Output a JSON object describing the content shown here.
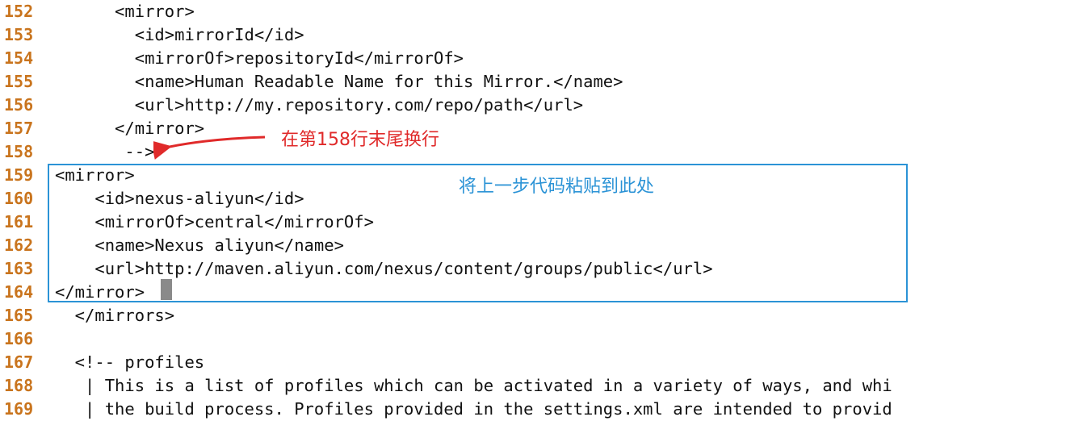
{
  "editor": {
    "lines": [
      {
        "number": "152",
        "text": "      <mirror>"
      },
      {
        "number": "153",
        "text": "        <id>mirrorId</id>"
      },
      {
        "number": "154",
        "text": "        <mirrorOf>repositoryId</mirrorOf>"
      },
      {
        "number": "155",
        "text": "        <name>Human Readable Name for this Mirror.</name>"
      },
      {
        "number": "156",
        "text": "        <url>http://my.repository.com/repo/path</url>"
      },
      {
        "number": "157",
        "text": "      </mirror>"
      },
      {
        "number": "158",
        "text": "       -->"
      },
      {
        "number": "159",
        "text": "<mirror>"
      },
      {
        "number": "160",
        "text": "    <id>nexus-aliyun</id>"
      },
      {
        "number": "161",
        "text": "    <mirrorOf>central</mirrorOf>"
      },
      {
        "number": "162",
        "text": "    <name>Nexus aliyun</name>"
      },
      {
        "number": "163",
        "text": "    <url>http://maven.aliyun.com/nexus/content/groups/public</url>"
      },
      {
        "number": "164",
        "text": "</mirror>"
      },
      {
        "number": "165",
        "text": "  </mirrors>"
      },
      {
        "number": "166",
        "text": ""
      },
      {
        "number": "167",
        "text": "  <!-- profiles"
      },
      {
        "number": "168",
        "text": "   | This is a list of profiles which can be activated in a variety of ways, and whi"
      },
      {
        "number": "169",
        "text": "   | the build process. Profiles provided in the settings.xml are intended to provid"
      }
    ]
  },
  "annotations": {
    "newline_note": "在第158行末尾换行",
    "paste_note": "将上一步代码粘贴到此处"
  },
  "colors": {
    "line_number": "#c9741d",
    "code_text": "#111111",
    "red_annotation": "#e02a2a",
    "blue_annotation": "#2b93d6",
    "cursor": "#8a8a8a"
  }
}
